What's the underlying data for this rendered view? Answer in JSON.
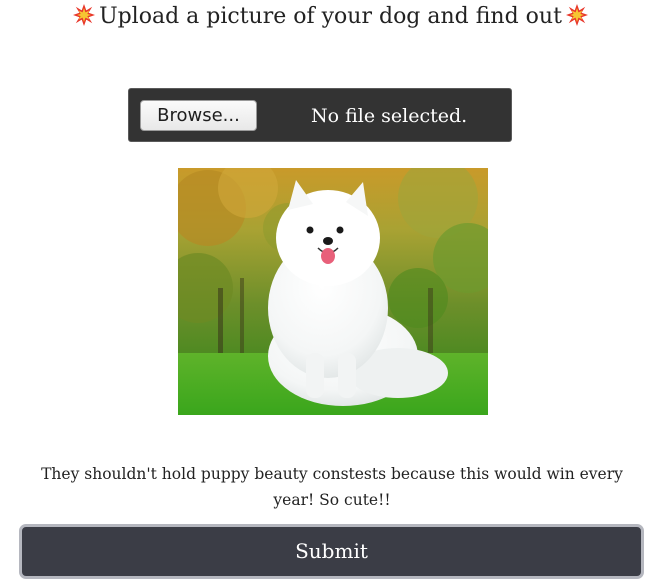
{
  "header": {
    "title": "Upload a picture of your dog and find out",
    "left_icon": "collision-icon",
    "right_icon": "collision-icon"
  },
  "file_input": {
    "button_label": "Browse...",
    "status_text": "No file selected."
  },
  "preview": {
    "subject": "white fluffy dog sitting on grass"
  },
  "result": {
    "text": "They shouldn't hold puppy beauty constests because this would win every year! So cute!!"
  },
  "submit": {
    "label": "Submit"
  },
  "colors": {
    "file_box_bg": "#333333",
    "submit_bg": "#3b3d46",
    "submit_border": "#b5b7bf",
    "text": "#222222"
  }
}
